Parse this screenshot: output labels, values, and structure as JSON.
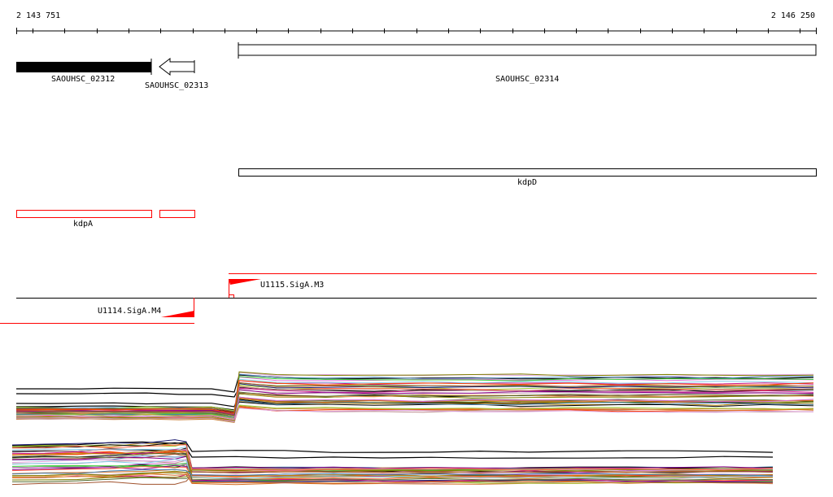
{
  "ruler": {
    "start_label": "2 143 751",
    "end_label": "2 146 250"
  },
  "genes": [
    {
      "id": "SAOUHSC_02312",
      "style": "filled",
      "strand": "+"
    },
    {
      "id": "SAOUHSC_02313",
      "style": "arrow",
      "strand": "-"
    },
    {
      "id": "SAOUHSC_02314",
      "style": "open",
      "strand": "+"
    }
  ],
  "operon_features": [
    {
      "label": "kdpD"
    },
    {
      "label": "kdpA"
    }
  ],
  "transcription_units": [
    {
      "label": "U1115.SigA.M3",
      "strand": "+"
    },
    {
      "label": "U1114.SigA.M4",
      "strand": "-"
    }
  ],
  "colors": {
    "feature_red": "#ff0000",
    "trace_palette": [
      "#000000",
      "#ff6347",
      "#8b008b",
      "#cd853f",
      "#b8860b",
      "#c71585",
      "#dda0dd",
      "#4682b4",
      "#87ceeb",
      "#6b8e23",
      "#9acd32",
      "#d2691e",
      "#a0522d",
      "#bc8f8f",
      "#808000",
      "#ff4500",
      "#da70d6",
      "#556b2f",
      "#32cd32",
      "#191970",
      "#c0a0b0",
      "#f4a460"
    ]
  }
}
